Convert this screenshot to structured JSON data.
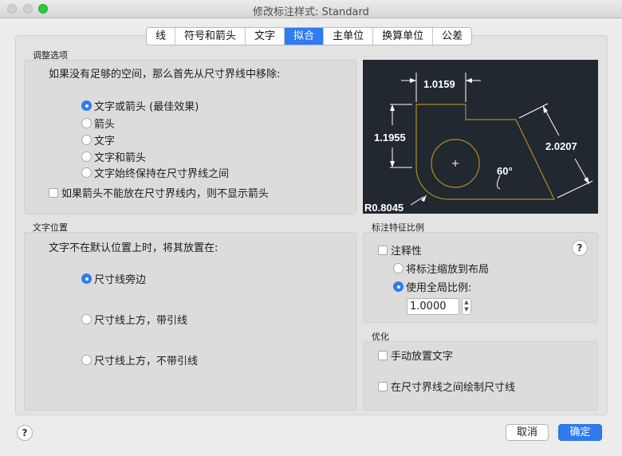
{
  "window": {
    "title": "修改标注样式: Standard"
  },
  "tabs": [
    "线",
    "符号和箭头",
    "文字",
    "拟合",
    "主单位",
    "换算单位",
    "公差"
  ],
  "active_tab": "拟合",
  "fit": {
    "section_label": "调整选项",
    "prompt": "如果没有足够的空间，那么首先从尺寸界线中移除:",
    "options": [
      "文字或箭头 (最佳效果)",
      "箭头",
      "文字",
      "文字和箭头",
      "文字始终保持在尺寸界线之间"
    ],
    "selected_index": 0,
    "suppress_arrows": "如果箭头不能放在尺寸界线内，则不显示箭头"
  },
  "preview": {
    "dim_top": "1.0159",
    "dim_left": "1.1955",
    "dim_right": "2.0207",
    "angle": "60°",
    "radius": "R0.8045"
  },
  "text_placement": {
    "section_label": "文字位置",
    "prompt": "文字不在默认位置上时，将其放置在:",
    "options": [
      "尺寸线旁边",
      "尺寸线上方，带引线",
      "尺寸线上方，不带引线"
    ],
    "selected_index": 0
  },
  "scale": {
    "section_label": "标注特征比例",
    "annotative": "注释性",
    "scale_to_layout": "将标注缩放到布局",
    "use_overall": "使用全局比例:",
    "overall_value": "1.0000",
    "help": "?"
  },
  "finetune": {
    "section_label": "优化",
    "manual_text": "手动放置文字",
    "draw_dim_line": "在尺寸界线之间绘制尺寸线"
  },
  "footer": {
    "help": "?",
    "cancel": "取消",
    "ok": "确定"
  },
  "colors": {
    "accent": "#2f7bf0",
    "preview_bg": "#212830",
    "preview_line": "#b38a2a"
  }
}
